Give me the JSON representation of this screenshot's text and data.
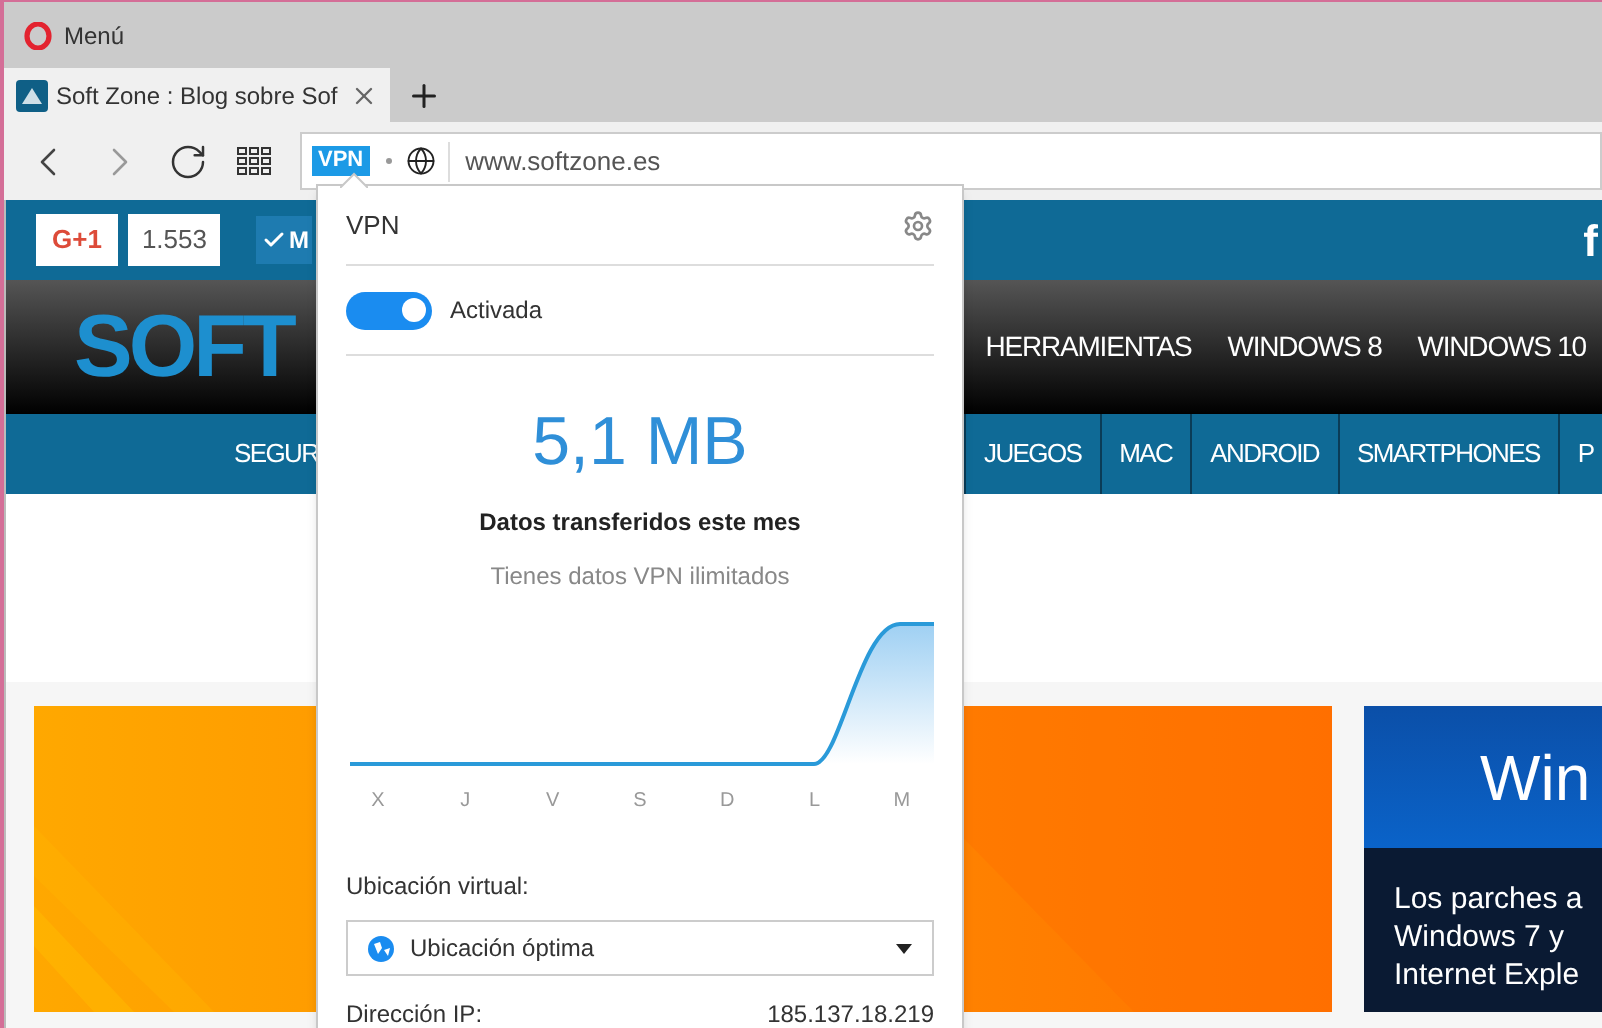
{
  "window": {
    "title": "Menú"
  },
  "tabs": [
    {
      "title": "Soft Zone : Blog sobre Sof",
      "selected": true
    }
  ],
  "address_bar": {
    "vpn_badge": "VPN",
    "url": "www.softzone.es"
  },
  "page": {
    "social": {
      "gplus_label": "G+1",
      "gplus_count": "1.553",
      "follow_label": "M",
      "facebook_label": "f"
    },
    "logo": "SOFT",
    "top_nav": [
      "HERRAMIENTAS",
      "WINDOWS 8",
      "WINDOWS 10"
    ],
    "main_nav": [
      "SEGUR",
      "JUEGOS",
      "MAC",
      "ANDROID",
      "SMARTPHONES",
      "P"
    ],
    "featured": {
      "heading": "Win",
      "caption_lines": [
        "Los parches a",
        "Windows 7 y",
        "Internet Exple"
      ]
    }
  },
  "vpn_popup": {
    "title": "VPN",
    "toggle": {
      "label": "Activada",
      "on": true
    },
    "data_amount": "5,1 MB",
    "data_label": "Datos transferidos este mes",
    "data_note": "Tienes datos VPN ilimitados",
    "day_labels": [
      "X",
      "J",
      "V",
      "S",
      "D",
      "L",
      "M"
    ],
    "location_label": "Ubicación virtual:",
    "location_value": "Ubicación óptima",
    "ip_label": "Dirección IP:",
    "ip_value": "185.137.18.219"
  }
}
